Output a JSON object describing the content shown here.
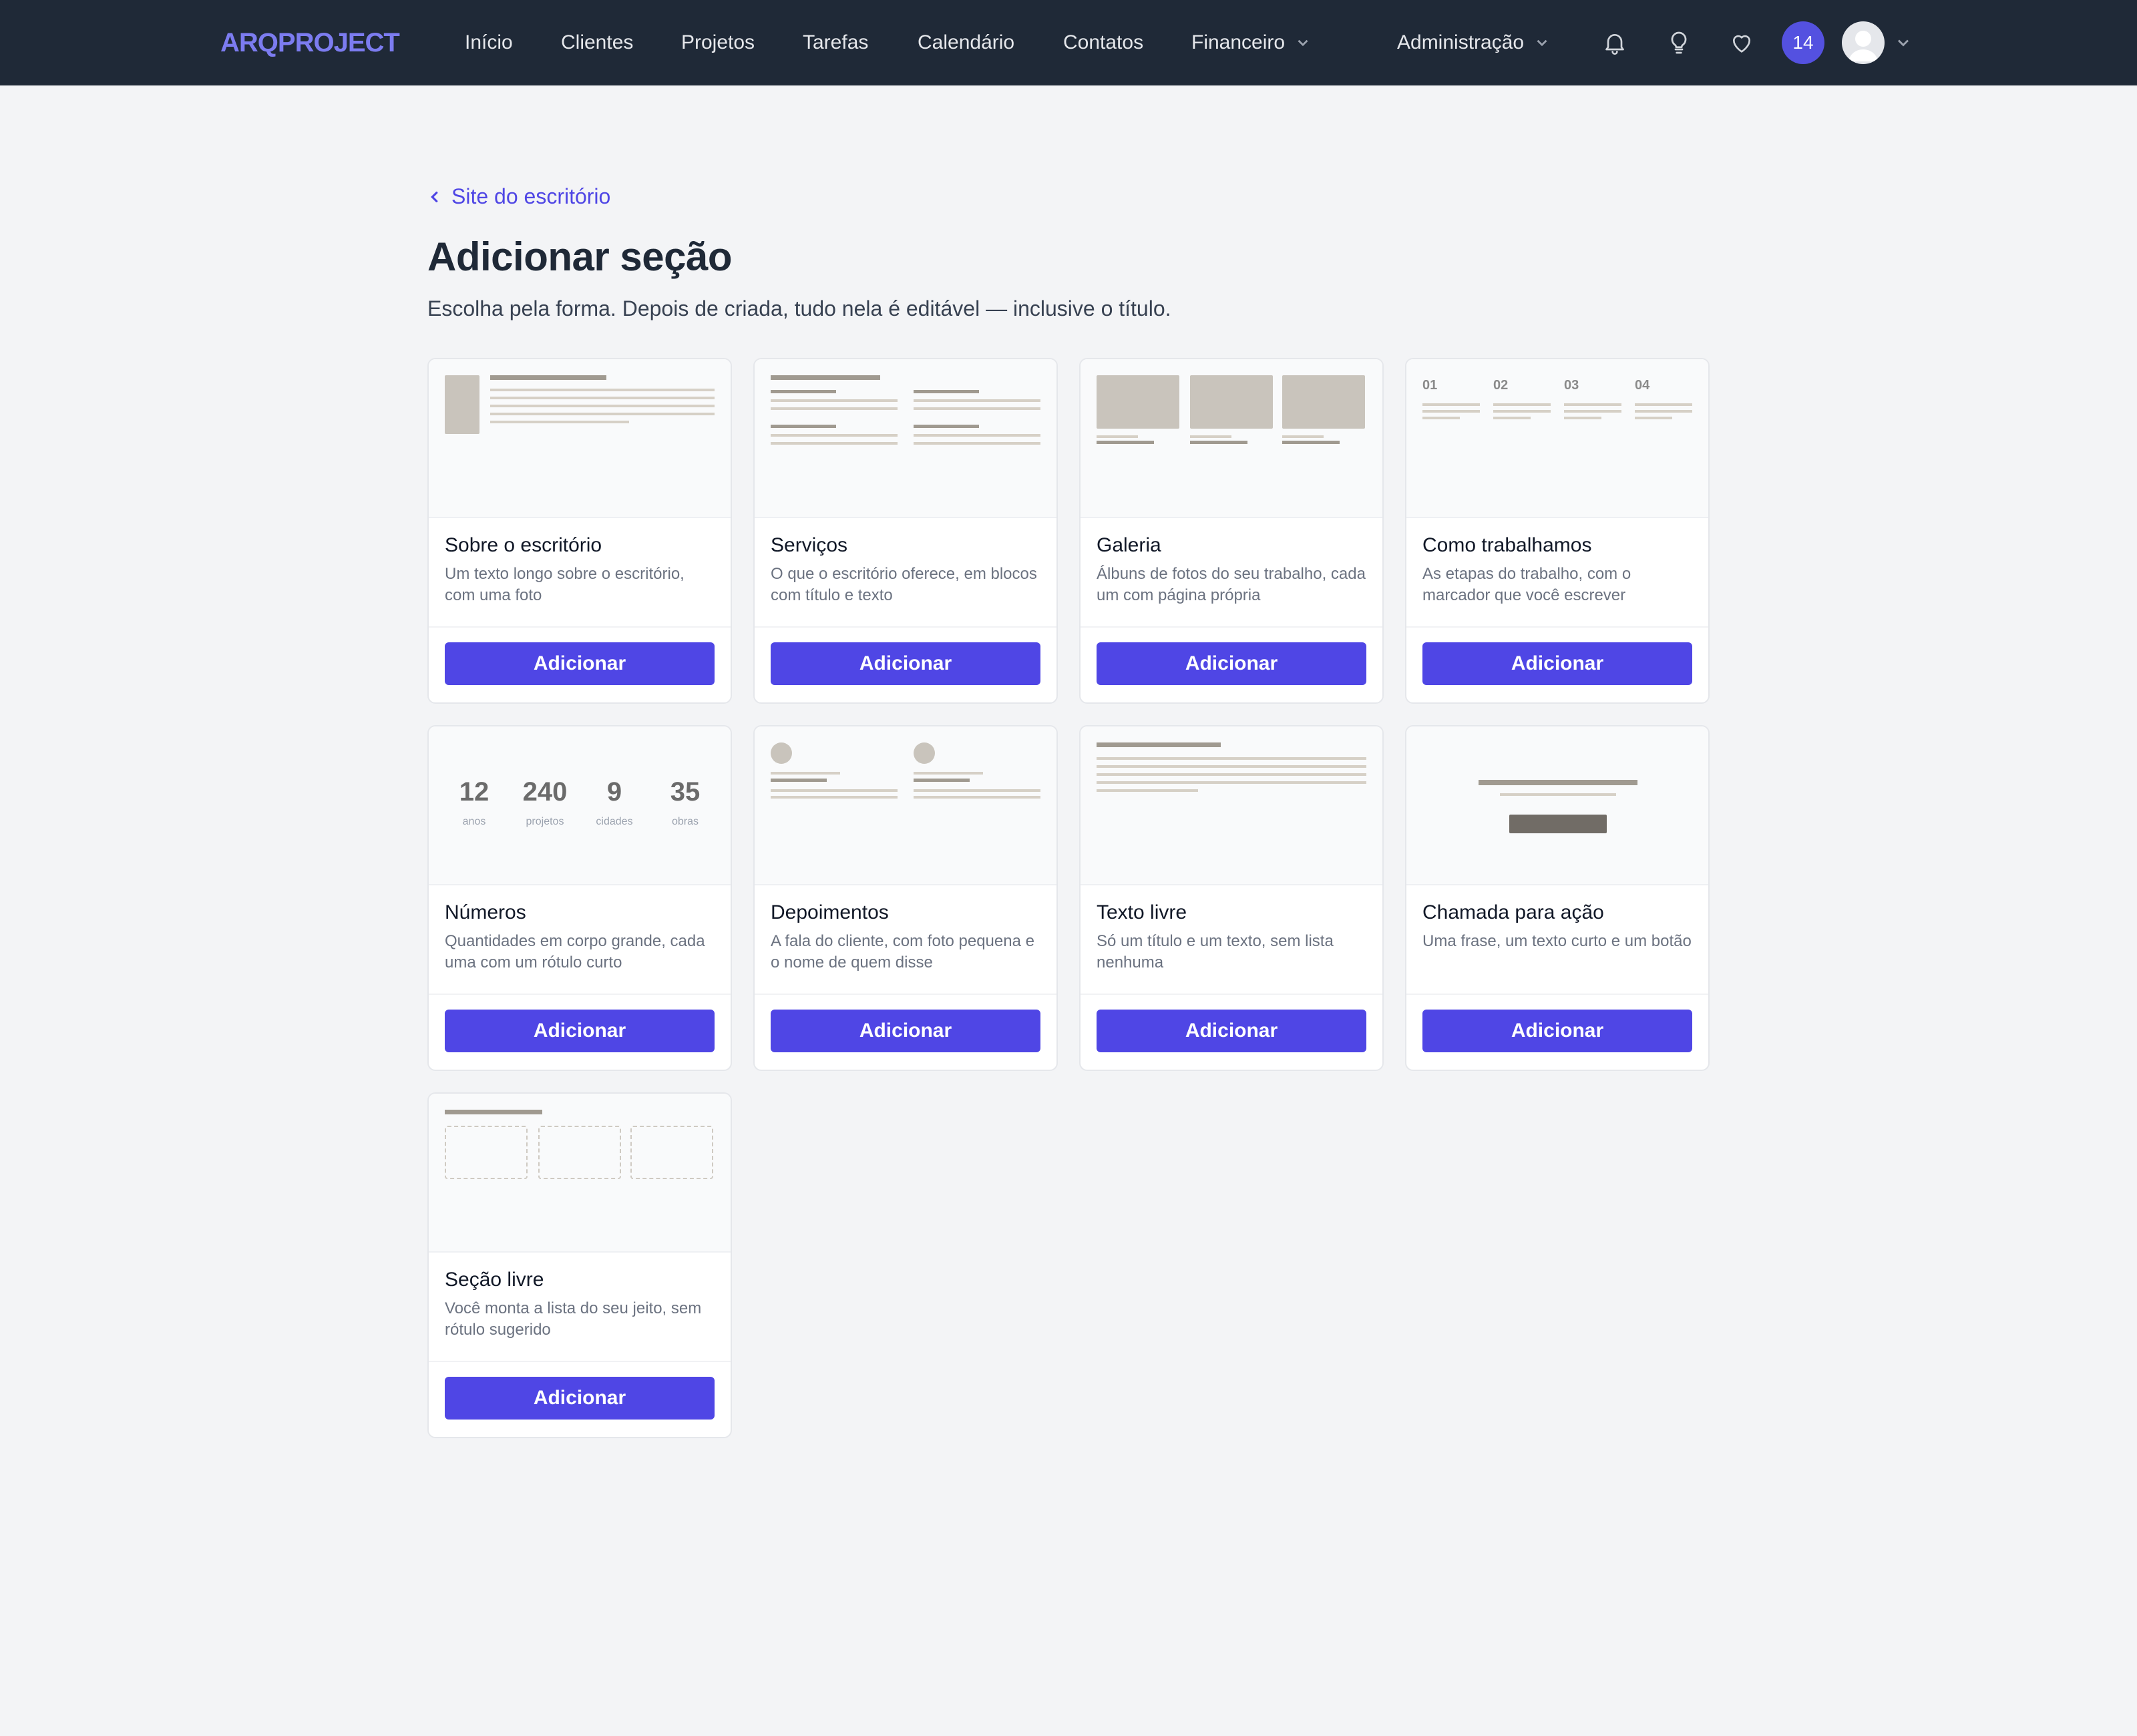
{
  "nav": {
    "logo": "ARQPROJECT",
    "items": [
      "Início",
      "Clientes",
      "Projetos",
      "Tarefas",
      "Calendário",
      "Contatos"
    ],
    "financeiro": "Financeiro",
    "administracao": "Administração",
    "badge_count": "14",
    "icons": [
      "bell-icon",
      "lightbulb-icon",
      "heart-icon"
    ]
  },
  "header": {
    "back_label": "Site do escritório",
    "title": "Adicionar seção",
    "subtitle": "Escolha pela forma. Depois de criada, tudo nela é editável — inclusive o título."
  },
  "cards": [
    {
      "title": "Sobre o escritório",
      "desc": "Um texto longo sobre o escritório, com uma foto",
      "button": "Adicionar"
    },
    {
      "title": "Serviços",
      "desc": "O que o escritório oferece, em blocos com título e texto",
      "button": "Adicionar"
    },
    {
      "title": "Galeria",
      "desc": "Álbuns de fotos do seu trabalho, cada um com página própria",
      "button": "Adicionar"
    },
    {
      "title": "Como trabalhamos",
      "desc": "As etapas do trabalho, com o marcador que você escrever",
      "button": "Adicionar"
    },
    {
      "title": "Números",
      "desc": "Quantidades em corpo grande, cada uma com um rótulo curto",
      "button": "Adicionar"
    },
    {
      "title": "Depoimentos",
      "desc": "A fala do cliente, com foto pequena e o nome de quem disse",
      "button": "Adicionar"
    },
    {
      "title": "Texto livre",
      "desc": "Só um título e um texto, sem lista nenhuma",
      "button": "Adicionar"
    },
    {
      "title": "Chamada para ação",
      "desc": "Uma frase, um texto curto e um botão",
      "button": "Adicionar"
    },
    {
      "title": "Seção livre",
      "desc": "Você monta a lista do seu jeito, sem rótulo sugerido",
      "button": "Adicionar"
    }
  ],
  "previews": {
    "steps": [
      "01",
      "02",
      "03",
      "04"
    ],
    "numbers": [
      {
        "value": "12",
        "label": "anos"
      },
      {
        "value": "240",
        "label": "projetos"
      },
      {
        "value": "9",
        "label": "cidades"
      },
      {
        "value": "35",
        "label": "obras"
      }
    ]
  }
}
